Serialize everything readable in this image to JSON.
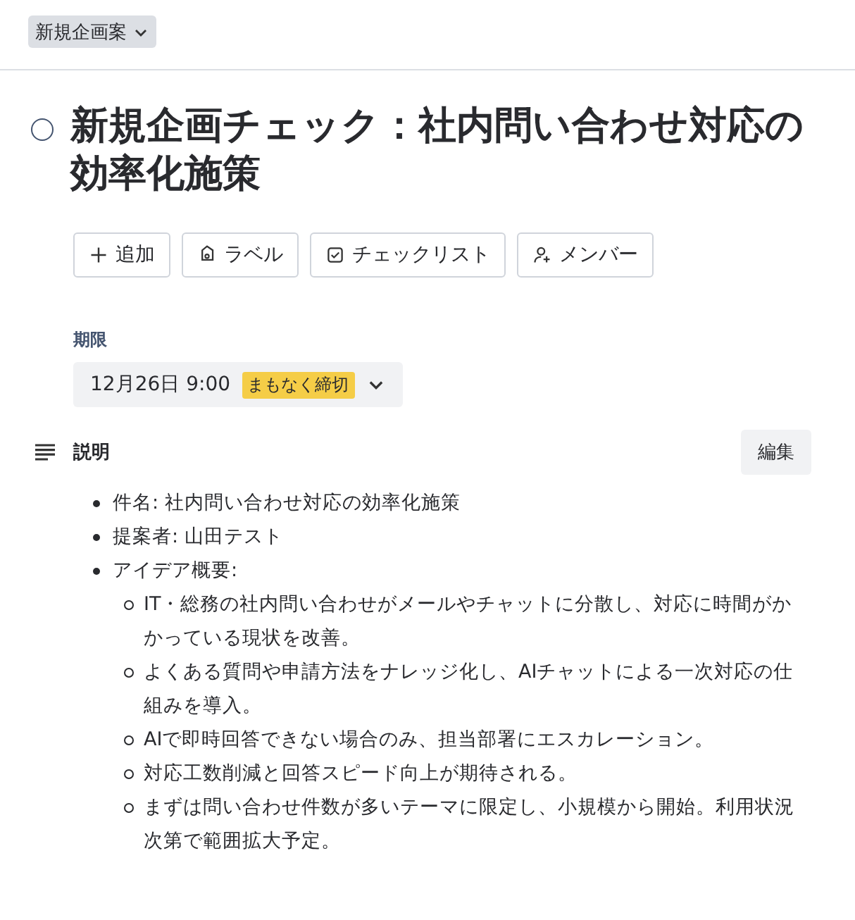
{
  "list_menu": {
    "label": "新規企画案"
  },
  "card": {
    "title": "新規企画チェック：社内問い合わせ対応の効率化施策",
    "completed": false
  },
  "actions": [
    {
      "kind": "add",
      "label": "追加"
    },
    {
      "kind": "label",
      "label": "ラベル"
    },
    {
      "kind": "checklist",
      "label": "チェックリスト"
    },
    {
      "kind": "member",
      "label": "メンバー"
    }
  ],
  "due": {
    "heading": "期限",
    "date": "12月26日 9:00",
    "badge": "まもなく締切"
  },
  "description": {
    "heading": "説明",
    "edit_button": "編集",
    "items": [
      {
        "text": "件名: 社内問い合わせ対応の効率化施策"
      },
      {
        "text": "提案者: 山田テスト"
      },
      {
        "text": "アイデア概要:",
        "children": [
          {
            "text": "IT・総務の社内問い合わせがメールやチャットに分散し、対応に時間がかかっている現状を改善。"
          },
          {
            "text": "よくある質問や申請方法をナレッジ化し、AIチャットによる一次対応の仕組みを導入。"
          },
          {
            "text": "AIで即時回答できない場合のみ、担当部署にエスカレーション。"
          },
          {
            "text": "対応工数削減と回答スピード向上が期待される。"
          },
          {
            "text": "まずは問い合わせ件数が多いテーマに限定し、小規模から開始。利用状況次第で範囲拡大予定。"
          }
        ]
      }
    ]
  }
}
